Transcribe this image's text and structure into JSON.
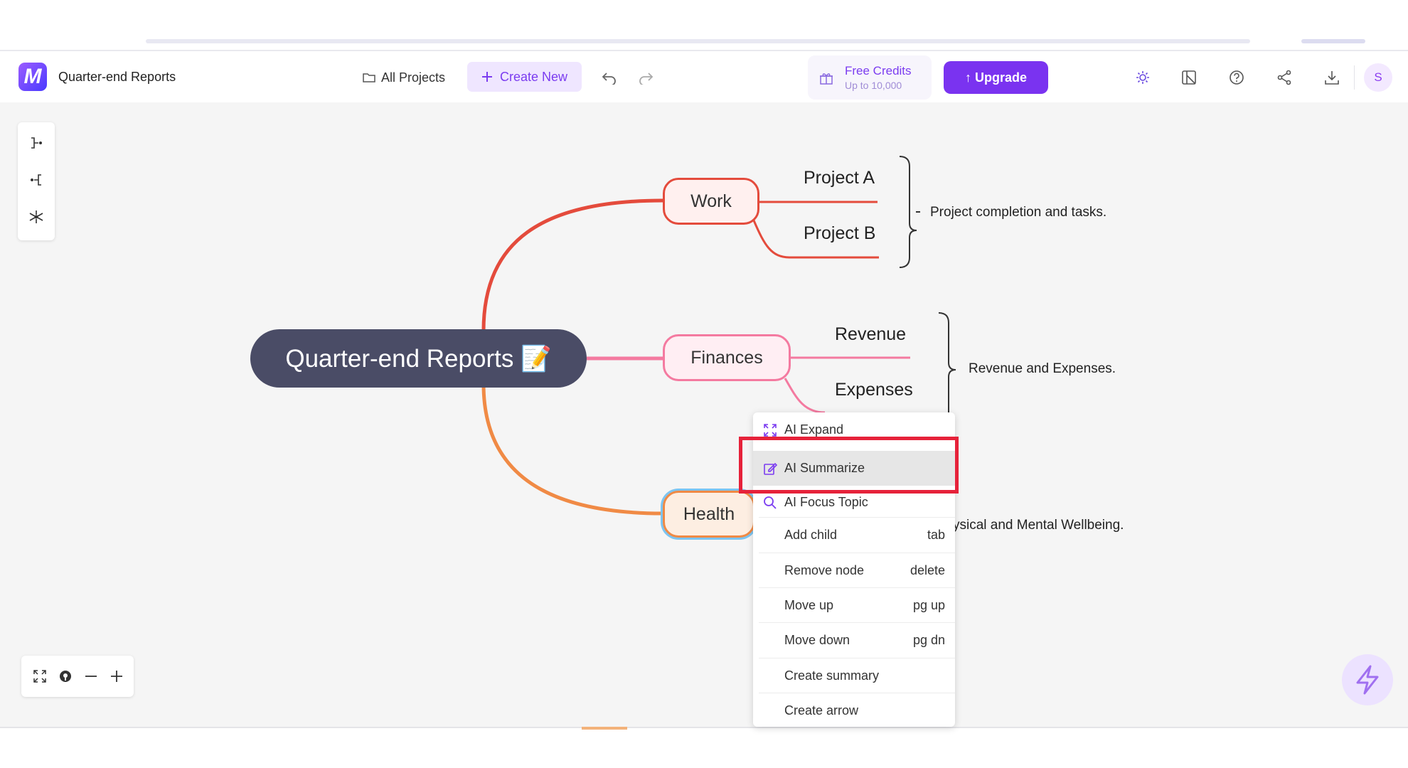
{
  "app": {
    "document_title": "Quarter-end Reports",
    "logo_letter": "M"
  },
  "header": {
    "all_projects": "All Projects",
    "create_new": "Create New",
    "credits_title": "Free Credits",
    "credits_sub": "Up to 10,000",
    "upgrade": "↑ Upgrade",
    "avatar": "S"
  },
  "mindmap": {
    "root": "Quarter-end Reports 📝",
    "branches": [
      {
        "label": "Work",
        "color": "#e44b3c",
        "children": [
          "Project A",
          "Project B"
        ],
        "summary": "Project completion and tasks."
      },
      {
        "label": "Finances",
        "color": "#f47aa0",
        "children": [
          "Revenue",
          "Expenses"
        ],
        "summary": "Revenue and Expenses."
      },
      {
        "label": "Health",
        "color": "#f08a45",
        "children": [],
        "summary": "ysical and Mental Wellbeing."
      }
    ]
  },
  "context_menu": {
    "items": [
      {
        "label": "AI Expand",
        "shortcut": "",
        "icon": "expand-icon"
      },
      {
        "label": "AI Summarize",
        "shortcut": "",
        "icon": "edit-icon",
        "highlighted": true
      },
      {
        "label": "AI Focus Topic",
        "shortcut": "",
        "icon": "search-icon"
      },
      {
        "label": "Add child",
        "shortcut": "tab"
      },
      {
        "label": "Remove node",
        "shortcut": "delete"
      },
      {
        "label": "Move up",
        "shortcut": "pg up"
      },
      {
        "label": "Move down",
        "shortcut": "pg dn"
      },
      {
        "label": "Create summary",
        "shortcut": ""
      },
      {
        "label": "Create arrow",
        "shortcut": ""
      }
    ]
  },
  "colors": {
    "accent": "#7a33f0",
    "root": "#4a4c66",
    "highlight_box": "#e6223a"
  }
}
